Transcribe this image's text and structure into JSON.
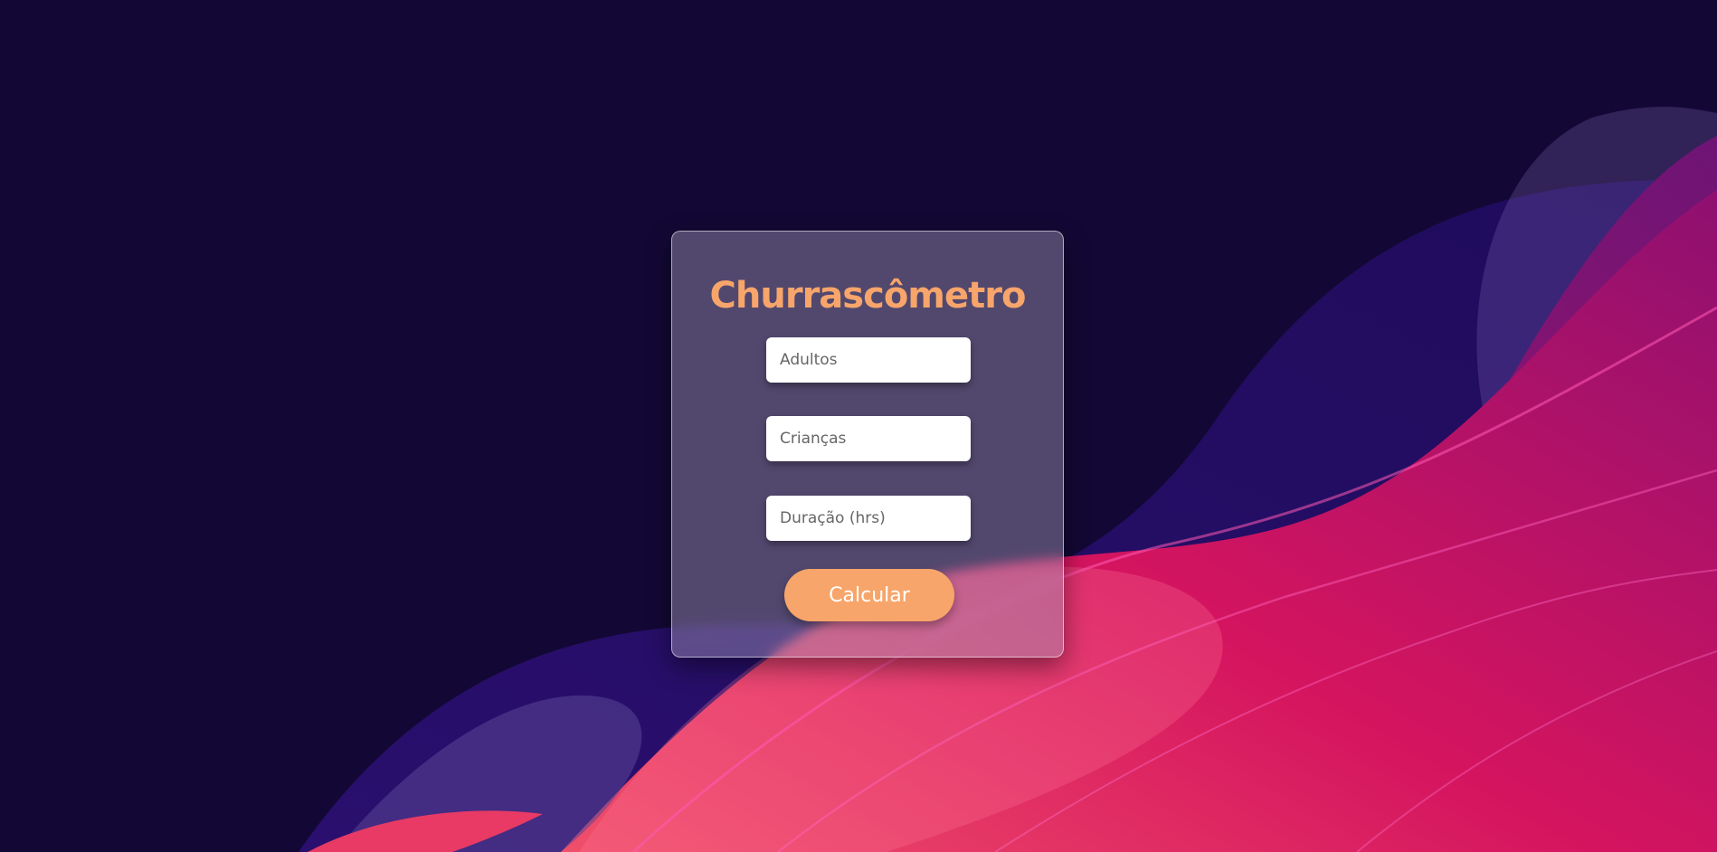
{
  "app": {
    "title": "Churrascômetro"
  },
  "form": {
    "adults_placeholder": "Adultos",
    "children_placeholder": "Crianças",
    "duration_placeholder": "Duração (hrs)",
    "submit_label": "Calcular"
  },
  "colors": {
    "background": "#130835",
    "accent": "#f7a56a",
    "wave_purple": "#24106a",
    "wave_pink": "#d81b66"
  }
}
